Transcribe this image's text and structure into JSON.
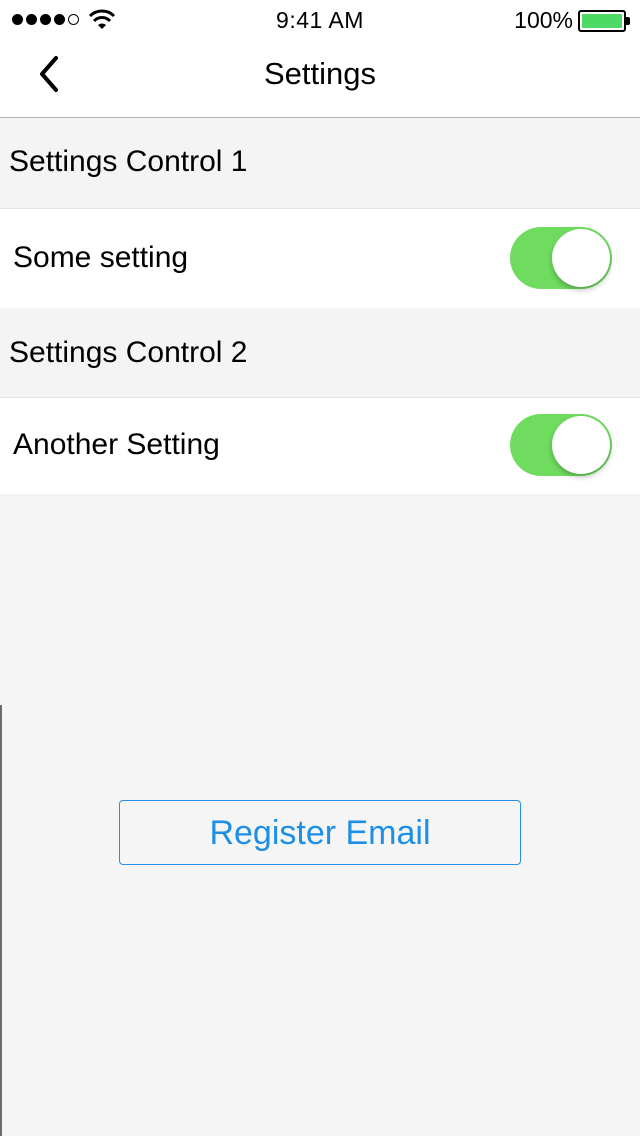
{
  "status_bar": {
    "time": "9:41 AM",
    "battery_percent": "100%",
    "signal_bars_filled": 4,
    "signal_bars_total": 5,
    "battery_level": 1.0,
    "battery_color": "#4cd964"
  },
  "nav": {
    "title": "Settings",
    "back_icon": "chevron-left-icon"
  },
  "sections": [
    {
      "header": "Settings Control 1",
      "row": {
        "label": "Some setting",
        "toggle_on": true
      }
    },
    {
      "header": "Settings Control 2",
      "row": {
        "label": "Another Setting",
        "toggle_on": true
      }
    }
  ],
  "colors": {
    "toggle_on": "#6fdc5f",
    "accent_blue": "#1d8fe6"
  },
  "register_button": {
    "label": "Register Email"
  }
}
